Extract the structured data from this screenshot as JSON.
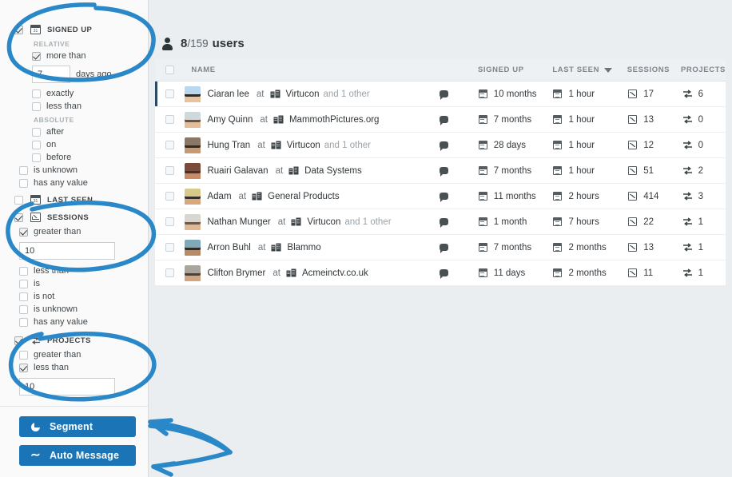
{
  "sidebar": {
    "groups": [
      {
        "id": "signed-up",
        "label": "SIGNED UP",
        "icon": "calendar-icon",
        "checked": true,
        "sections": [
          {
            "heading": "RELATIVE",
            "options": [
              {
                "label": "more than",
                "checked": true
              },
              {
                "label": "exactly",
                "checked": false
              },
              {
                "label": "less than",
                "checked": false
              }
            ]
          },
          {
            "heading": "ABSOLUTE",
            "options": [
              {
                "label": "after",
                "checked": false
              },
              {
                "label": "on",
                "checked": false
              },
              {
                "label": "before",
                "checked": false
              }
            ]
          }
        ],
        "extra_options": [
          {
            "label": "is unknown",
            "checked": false
          },
          {
            "label": "has any value",
            "checked": false
          }
        ],
        "input_value": "7",
        "input_suffix": "days ago"
      },
      {
        "id": "last-seen",
        "label": "LAST SEEN",
        "icon": "calendar-icon",
        "checked": false
      },
      {
        "id": "sessions",
        "label": "SESSIONS",
        "icon": "chart-icon",
        "checked": true,
        "options": [
          {
            "label": "greater than",
            "checked": true
          },
          {
            "label": "less than",
            "checked": false
          },
          {
            "label": "is",
            "checked": false
          },
          {
            "label": "is not",
            "checked": false
          },
          {
            "label": "is unknown",
            "checked": false
          },
          {
            "label": "has any value",
            "checked": false
          }
        ],
        "input_value": "10"
      },
      {
        "id": "projects",
        "label": "PROJECTS",
        "icon": "transfer-icon",
        "checked": true,
        "options": [
          {
            "label": "greater than",
            "checked": false
          },
          {
            "label": "less than",
            "checked": true
          }
        ],
        "input_value": "10"
      }
    ],
    "actions": [
      {
        "id": "segment",
        "label": "Segment",
        "icon": "pie-icon",
        "color": "#1b74b5"
      },
      {
        "id": "auto-message",
        "label": "Auto Message",
        "icon": "wave-icon",
        "color": "#1b74b5"
      }
    ]
  },
  "main": {
    "count": {
      "shown": "8",
      "separator": "/",
      "total": "159",
      "word": "users"
    },
    "columns": [
      {
        "key": "name",
        "label": "NAME",
        "sorted": false
      },
      {
        "key": "signed_up",
        "label": "SIGNED UP",
        "sorted": false
      },
      {
        "key": "last_seen",
        "label": "LAST SEEN",
        "sorted": true,
        "sort_dir": "desc"
      },
      {
        "key": "sessions",
        "label": "SESSIONS",
        "sorted": false
      },
      {
        "key": "projects",
        "label": "PROJECTS",
        "sorted": false
      }
    ],
    "rows": [
      {
        "name": "Ciaran lee",
        "at": "at",
        "company": "Virtucon",
        "other": "and 1 other",
        "signed_up": "10 months",
        "last_seen": "1 hour",
        "sessions": "17",
        "projects": "6",
        "avatar_bg": "#b9d7ee",
        "avatar_hair": "#2d2a28",
        "avatar_skin": "#e8c39e"
      },
      {
        "name": "Amy Quinn",
        "at": "at",
        "company": "MammothPictures.org",
        "other": "",
        "signed_up": "7 months",
        "last_seen": "1 hour",
        "sessions": "13",
        "projects": "0",
        "avatar_bg": "#cfd9dd",
        "avatar_hair": "#6b5440",
        "avatar_skin": "#e4bd9a"
      },
      {
        "name": "Hung Tran",
        "at": "at",
        "company": "Virtucon",
        "other": "and 1 other",
        "signed_up": "28 days",
        "last_seen": "1 hour",
        "sessions": "12",
        "projects": "0",
        "avatar_bg": "#8a7766",
        "avatar_hair": "#3a2b20",
        "avatar_skin": "#c79a73"
      },
      {
        "name": "Ruairi Galavan",
        "at": "at",
        "company": "Data Systems",
        "other": "",
        "signed_up": "7 months",
        "last_seen": "1 hour",
        "sessions": "51",
        "projects": "2",
        "avatar_bg": "#7b4a3a",
        "avatar_hair": "#4a2f22",
        "avatar_skin": "#c98a66"
      },
      {
        "name": "Adam",
        "at": "at",
        "company": "General Products",
        "other": "",
        "signed_up": "11 months",
        "last_seen": "2 hours",
        "sessions": "414",
        "projects": "3",
        "avatar_bg": "#d6c98a",
        "avatar_hair": "#33302c",
        "avatar_skin": "#d8a87d"
      },
      {
        "name": "Nathan Munger",
        "at": "at",
        "company": "Virtucon",
        "other": "and 1 other",
        "signed_up": "1 month",
        "last_seen": "7 hours",
        "sessions": "22",
        "projects": "1",
        "avatar_bg": "#d8d6cf",
        "avatar_hair": "#6a5a4a",
        "avatar_skin": "#e0b892"
      },
      {
        "name": "Arron Buhl",
        "at": "at",
        "company": "Blammo",
        "other": "",
        "signed_up": "7 months",
        "last_seen": "2 months",
        "sessions": "13",
        "projects": "1",
        "avatar_bg": "#7fa9b8",
        "avatar_hair": "#322a24",
        "avatar_skin": "#b98a63"
      },
      {
        "name": "Clifton Brymer",
        "at": "at",
        "company": "Acmeinctv.co.uk",
        "other": "",
        "signed_up": "11 days",
        "last_seen": "2 months",
        "sessions": "11",
        "projects": "1",
        "avatar_bg": "#a9a49c",
        "avatar_hair": "#4e4238",
        "avatar_skin": "#d2a681"
      }
    ]
  },
  "annotations": {
    "color": "#2a88c8",
    "shapes": [
      "ellipse-signed-up",
      "ellipse-sessions",
      "ellipse-projects",
      "arrow-segment",
      "arrow-auto-message"
    ]
  }
}
